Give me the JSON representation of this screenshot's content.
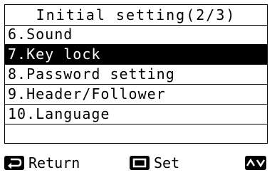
{
  "header": {
    "title": "Initial setting(2/3)"
  },
  "menu": {
    "items": [
      {
        "label": "6.Sound",
        "selected": false
      },
      {
        "label": "7.Key lock",
        "selected": true
      },
      {
        "label": "8.Password setting",
        "selected": false
      },
      {
        "label": "9.Header/Follower",
        "selected": false
      },
      {
        "label": "10.Language",
        "selected": false
      }
    ]
  },
  "footer": {
    "return_label": "Return",
    "set_label": "Set",
    "return_icon": "return-arrow-icon",
    "set_icon": "square-button-icon",
    "nav_icon": "up-down-arrows-icon"
  }
}
